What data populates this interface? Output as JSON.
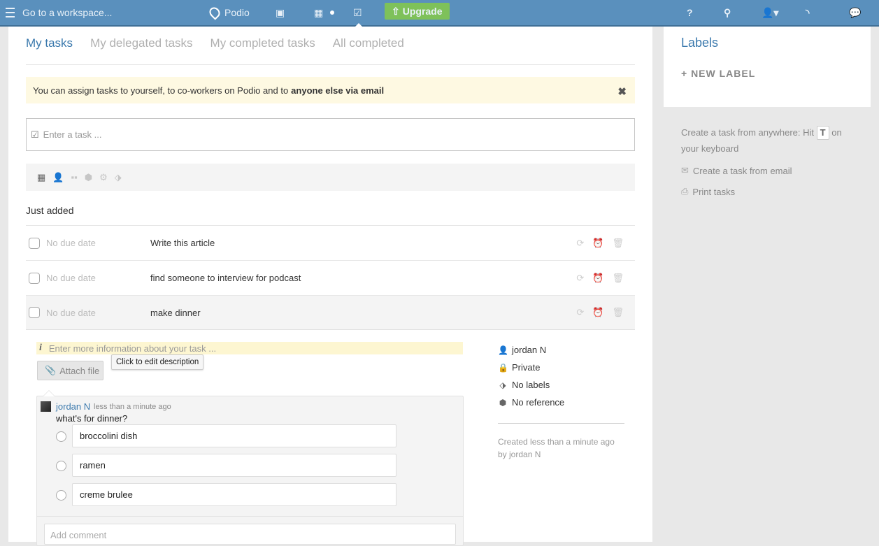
{
  "topbar": {
    "workspace_placeholder": "Go to a workspace...",
    "app_name": "Podio",
    "upgrade_label": "Upgrade",
    "icons": [
      "menu-icon",
      "contacts-icon",
      "calendar-icon",
      "tasks-icon",
      "help-icon",
      "search-icon",
      "user-icon",
      "activity-feed-icon",
      "chat-icon"
    ]
  },
  "tabs": [
    {
      "label": "My tasks",
      "active": true
    },
    {
      "label": "My delegated tasks",
      "active": false
    },
    {
      "label": "My completed tasks",
      "active": false
    },
    {
      "label": "All completed",
      "active": false
    }
  ],
  "notice": {
    "text": "You can assign tasks to yourself, to co-workers on Podio and to",
    "bold": "anyone else via email",
    "close": "✖"
  },
  "task_input": {
    "placeholder": "Enter a task ..."
  },
  "toolbar_icons": [
    "calendar-icon",
    "person-icon",
    "apps-icon",
    "reference-icon",
    "settings-icon",
    "label-icon"
  ],
  "section": {
    "title": "Just added"
  },
  "tasks": [
    {
      "due": "No due date",
      "title": "Write this article"
    },
    {
      "due": "No due date",
      "title": "find someone to interview for podcast"
    },
    {
      "due": "No due date",
      "title": "make dinner"
    }
  ],
  "expanded": {
    "description_placeholder": "Enter more information about your task ...",
    "tooltip": "Click to edit description",
    "attach_label": "Attach file",
    "comment": {
      "author": "jordan N",
      "time": "less than a minute ago",
      "text": "what's for dinner?",
      "poll_options": [
        "broccolini dish",
        "ramen",
        "creme brulee"
      ]
    },
    "add_comment_placeholder": "Add comment",
    "meta": {
      "assignee": "jordan N",
      "privacy": "Private",
      "labels": "No labels",
      "reference": "No reference"
    },
    "created_line1": "Created less than a minute ago",
    "created_line2": "by jordan N"
  },
  "sidebar": {
    "labels_title": "Labels",
    "new_label": "+ NEW LABEL",
    "tip_before": "Create a task from anywhere: Hit",
    "tip_key": "T",
    "tip_after": "on your keyboard",
    "email_link": "Create a task from email",
    "print_link": "Print tasks"
  },
  "colors": {
    "topbar": "#5a90bd",
    "accent": "#3b79ad",
    "upgrade": "#7ec15a",
    "notice_bg": "#fef9e2"
  }
}
